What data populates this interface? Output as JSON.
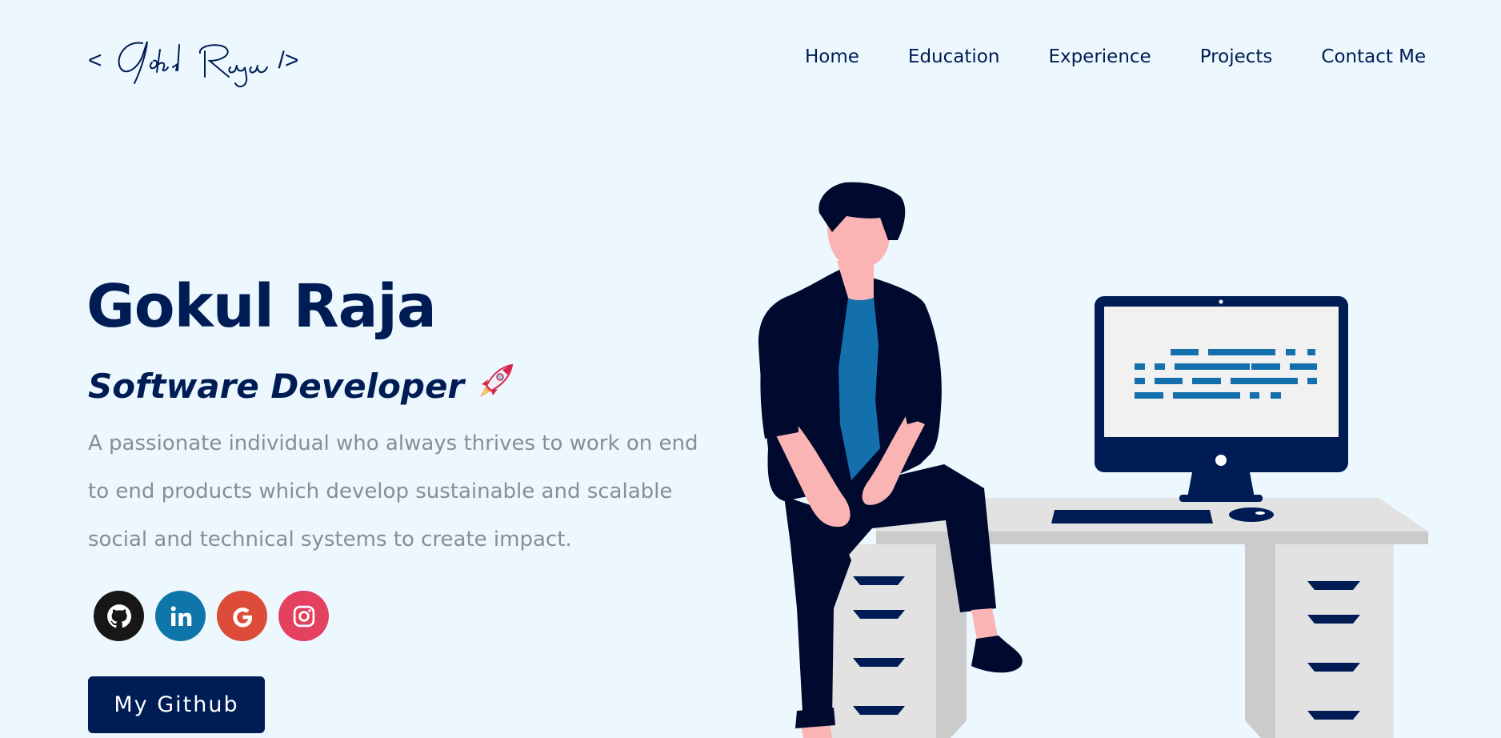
{
  "header": {
    "logo": {
      "open": "<",
      "signature": "Gokul Raja",
      "close": "/>"
    },
    "nav": [
      {
        "label": "Home"
      },
      {
        "label": "Education"
      },
      {
        "label": "Experience"
      },
      {
        "label": "Projects"
      },
      {
        "label": "Contact Me"
      }
    ]
  },
  "hero": {
    "name": "Gokul Raja",
    "title": "Software Developer",
    "title_icon": "rocket-icon",
    "description": "A passionate individual who always thrives to work on end to end products which develop sustainable and scalable social and technical systems to create impact.",
    "socials": [
      {
        "icon": "github-icon",
        "color": "#181717"
      },
      {
        "icon": "linkedin-icon",
        "color": "#0e76a8"
      },
      {
        "icon": "google-icon",
        "color": "#dd4b39"
      },
      {
        "icon": "instagram-icon",
        "color": "#e4405f"
      }
    ],
    "button_label": "My Github"
  },
  "colors": {
    "background": "#ecf8fe",
    "primary": "#001c55",
    "muted_text": "#868e96"
  }
}
